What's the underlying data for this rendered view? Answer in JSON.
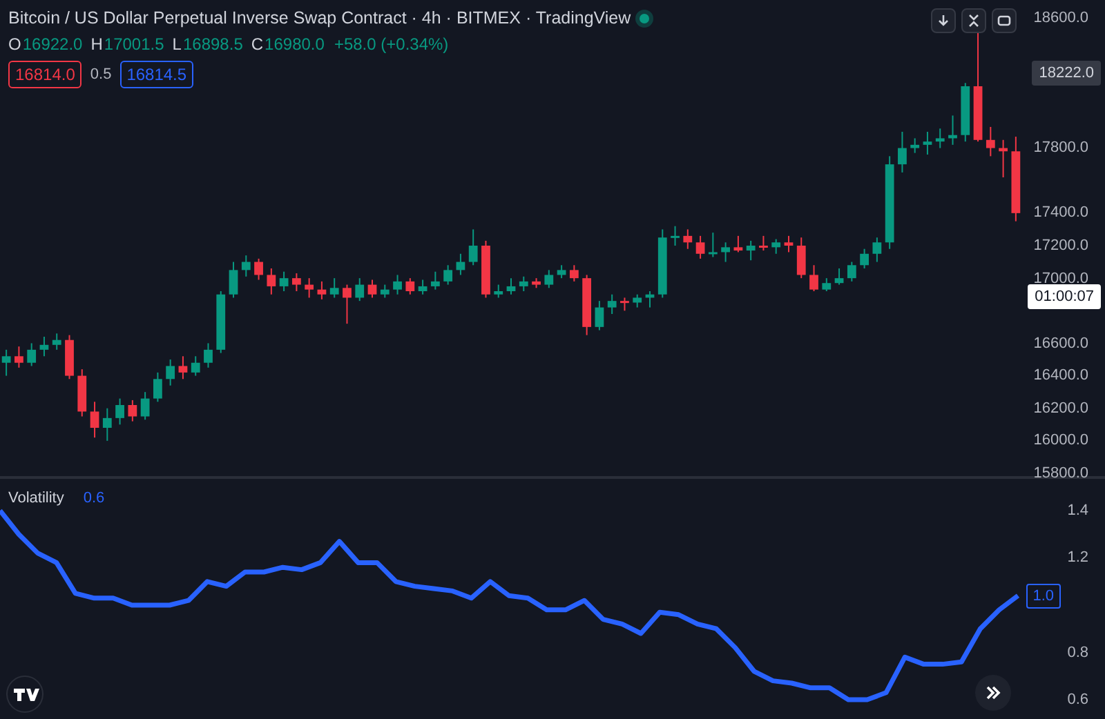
{
  "header": {
    "title": "Bitcoin / US Dollar Perpetual Inverse Swap Contract · 4h · BITMEX · TradingView",
    "market_open": true,
    "ohlc": [
      {
        "key": "O",
        "value": "16922.0"
      },
      {
        "key": "H",
        "value": "17001.5"
      },
      {
        "key": "L",
        "value": "16898.5"
      },
      {
        "key": "C",
        "value": "16980.0"
      }
    ],
    "change": "+58.0 (+0.34%)",
    "bid": "16814.0",
    "spread": "0.5",
    "ask": "16814.5"
  },
  "price_chart": {
    "last_price": "18222.0",
    "countdown": "01:00:07",
    "chart_data": {
      "type": "candlestick",
      "ylim": [
        15800,
        18600
      ],
      "yticks": [
        {
          "value": 18600,
          "label": "18600.0"
        },
        {
          "value": 17800,
          "label": "17800.0"
        },
        {
          "value": 17400,
          "label": "17400.0"
        },
        {
          "value": 17200,
          "label": "17200.0"
        },
        {
          "value": 17000,
          "label": "17000.0"
        },
        {
          "value": 16600,
          "label": "16600.0"
        },
        {
          "value": 16400,
          "label": "16400.0"
        },
        {
          "value": 16200,
          "label": "16200.0"
        },
        {
          "value": 16000,
          "label": "16000.0"
        },
        {
          "value": 15800,
          "label": "15800.0"
        }
      ],
      "ohlc": [
        [
          16480,
          16560,
          16400,
          16520
        ],
        [
          16520,
          16580,
          16450,
          16480
        ],
        [
          16480,
          16600,
          16460,
          16560
        ],
        [
          16560,
          16640,
          16520,
          16590
        ],
        [
          16590,
          16660,
          16560,
          16620
        ],
        [
          16620,
          16650,
          16380,
          16400
        ],
        [
          16400,
          16440,
          16150,
          16180
        ],
        [
          16180,
          16240,
          16020,
          16080
        ],
        [
          16080,
          16200,
          16000,
          16140
        ],
        [
          16140,
          16260,
          16100,
          16220
        ],
        [
          16220,
          16250,
          16120,
          16150
        ],
        [
          16150,
          16300,
          16130,
          16260
        ],
        [
          16260,
          16420,
          16240,
          16380
        ],
        [
          16380,
          16500,
          16340,
          16460
        ],
        [
          16460,
          16520,
          16380,
          16420
        ],
        [
          16420,
          16520,
          16400,
          16480
        ],
        [
          16480,
          16600,
          16450,
          16560
        ],
        [
          16560,
          16920,
          16540,
          16900
        ],
        [
          16900,
          17100,
          16880,
          17050
        ],
        [
          17050,
          17140,
          17010,
          17100
        ],
        [
          17100,
          17120,
          16990,
          17020
        ],
        [
          17020,
          17060,
          16900,
          16950
        ],
        [
          16950,
          17040,
          16920,
          17000
        ],
        [
          17000,
          17030,
          16920,
          16960
        ],
        [
          16960,
          17000,
          16880,
          16930
        ],
        [
          16930,
          16980,
          16870,
          16900
        ],
        [
          16900,
          17000,
          16880,
          16940
        ],
        [
          16940,
          16960,
          16720,
          16880
        ],
        [
          16880,
          17000,
          16860,
          16960
        ],
        [
          16960,
          16990,
          16880,
          16900
        ],
        [
          16900,
          16960,
          16880,
          16930
        ],
        [
          16930,
          17020,
          16900,
          16980
        ],
        [
          16980,
          17000,
          16900,
          16920
        ],
        [
          16920,
          16990,
          16900,
          16950
        ],
        [
          16950,
          17040,
          16930,
          16980
        ],
        [
          16980,
          17080,
          16960,
          17050
        ],
        [
          17050,
          17150,
          17020,
          17100
        ],
        [
          17100,
          17300,
          17080,
          17200
        ],
        [
          17200,
          17230,
          16880,
          16900
        ],
        [
          16900,
          16960,
          16880,
          16920
        ],
        [
          16920,
          17000,
          16900,
          16950
        ],
        [
          16950,
          17010,
          16920,
          16980
        ],
        [
          16980,
          17000,
          16940,
          16960
        ],
        [
          16960,
          17050,
          16940,
          17020
        ],
        [
          17020,
          17080,
          17000,
          17050
        ],
        [
          17050,
          17080,
          16980,
          17000
        ],
        [
          17000,
          17020,
          16650,
          16700
        ],
        [
          16700,
          16860,
          16680,
          16820
        ],
        [
          16820,
          16900,
          16780,
          16860
        ],
        [
          16860,
          16880,
          16800,
          16850
        ],
        [
          16850,
          16900,
          16820,
          16880
        ],
        [
          16880,
          16920,
          16820,
          16900
        ],
        [
          16900,
          17300,
          16880,
          17250
        ],
        [
          17250,
          17320,
          17200,
          17260
        ],
        [
          17260,
          17300,
          17180,
          17220
        ],
        [
          17220,
          17260,
          17120,
          17150
        ],
        [
          17150,
          17280,
          17130,
          17160
        ],
        [
          17160,
          17220,
          17100,
          17190
        ],
        [
          17190,
          17260,
          17160,
          17170
        ],
        [
          17170,
          17230,
          17110,
          17200
        ],
        [
          17200,
          17260,
          17170,
          17190
        ],
        [
          17190,
          17240,
          17150,
          17220
        ],
        [
          17220,
          17260,
          17160,
          17200
        ],
        [
          17200,
          17250,
          17000,
          17020
        ],
        [
          17020,
          17080,
          16920,
          16930
        ],
        [
          16930,
          17000,
          16920,
          16970
        ],
        [
          16970,
          17060,
          16960,
          17000
        ],
        [
          17000,
          17100,
          16980,
          17080
        ],
        [
          17080,
          17180,
          17060,
          17150
        ],
        [
          17150,
          17250,
          17100,
          17220
        ],
        [
          17220,
          17750,
          17180,
          17700
        ],
        [
          17700,
          17900,
          17650,
          17800
        ],
        [
          17800,
          17860,
          17770,
          17820
        ],
        [
          17820,
          17900,
          17760,
          17840
        ],
        [
          17840,
          17920,
          17800,
          17860
        ],
        [
          17860,
          18000,
          17820,
          17880
        ],
        [
          17880,
          18200,
          17840,
          18180
        ],
        [
          18180,
          18520,
          17840,
          17850
        ],
        [
          17850,
          17930,
          17750,
          17800
        ],
        [
          17800,
          17850,
          17620,
          17780
        ],
        [
          17780,
          17870,
          17350,
          17400
        ]
      ]
    }
  },
  "volatility": {
    "value": "0.6",
    "last_value": "1.0",
    "chart_data": {
      "type": "line",
      "ylim": [
        0.6,
        1.4
      ],
      "yticks": [
        {
          "value": 1.4,
          "label": "1.4"
        },
        {
          "value": 1.2,
          "label": "1.2"
        },
        {
          "value": 0.8,
          "label": "0.8"
        },
        {
          "value": 0.6,
          "label": "0.6"
        }
      ],
      "series": [
        {
          "name": "Volatility",
          "color": "#2962ff",
          "values": [
            1.4,
            1.3,
            1.22,
            1.18,
            1.05,
            1.03,
            1.03,
            1.0,
            1.0,
            1.0,
            1.02,
            1.1,
            1.08,
            1.14,
            1.14,
            1.16,
            1.15,
            1.18,
            1.27,
            1.18,
            1.18,
            1.1,
            1.08,
            1.07,
            1.06,
            1.03,
            1.1,
            1.04,
            1.03,
            0.98,
            0.98,
            1.02,
            0.94,
            0.92,
            0.88,
            0.97,
            0.96,
            0.92,
            0.9,
            0.82,
            0.72,
            0.68,
            0.67,
            0.65,
            0.65,
            0.6,
            0.6,
            0.63,
            0.78,
            0.75,
            0.75,
            0.76,
            0.9,
            0.98,
            1.04
          ]
        }
      ]
    }
  }
}
